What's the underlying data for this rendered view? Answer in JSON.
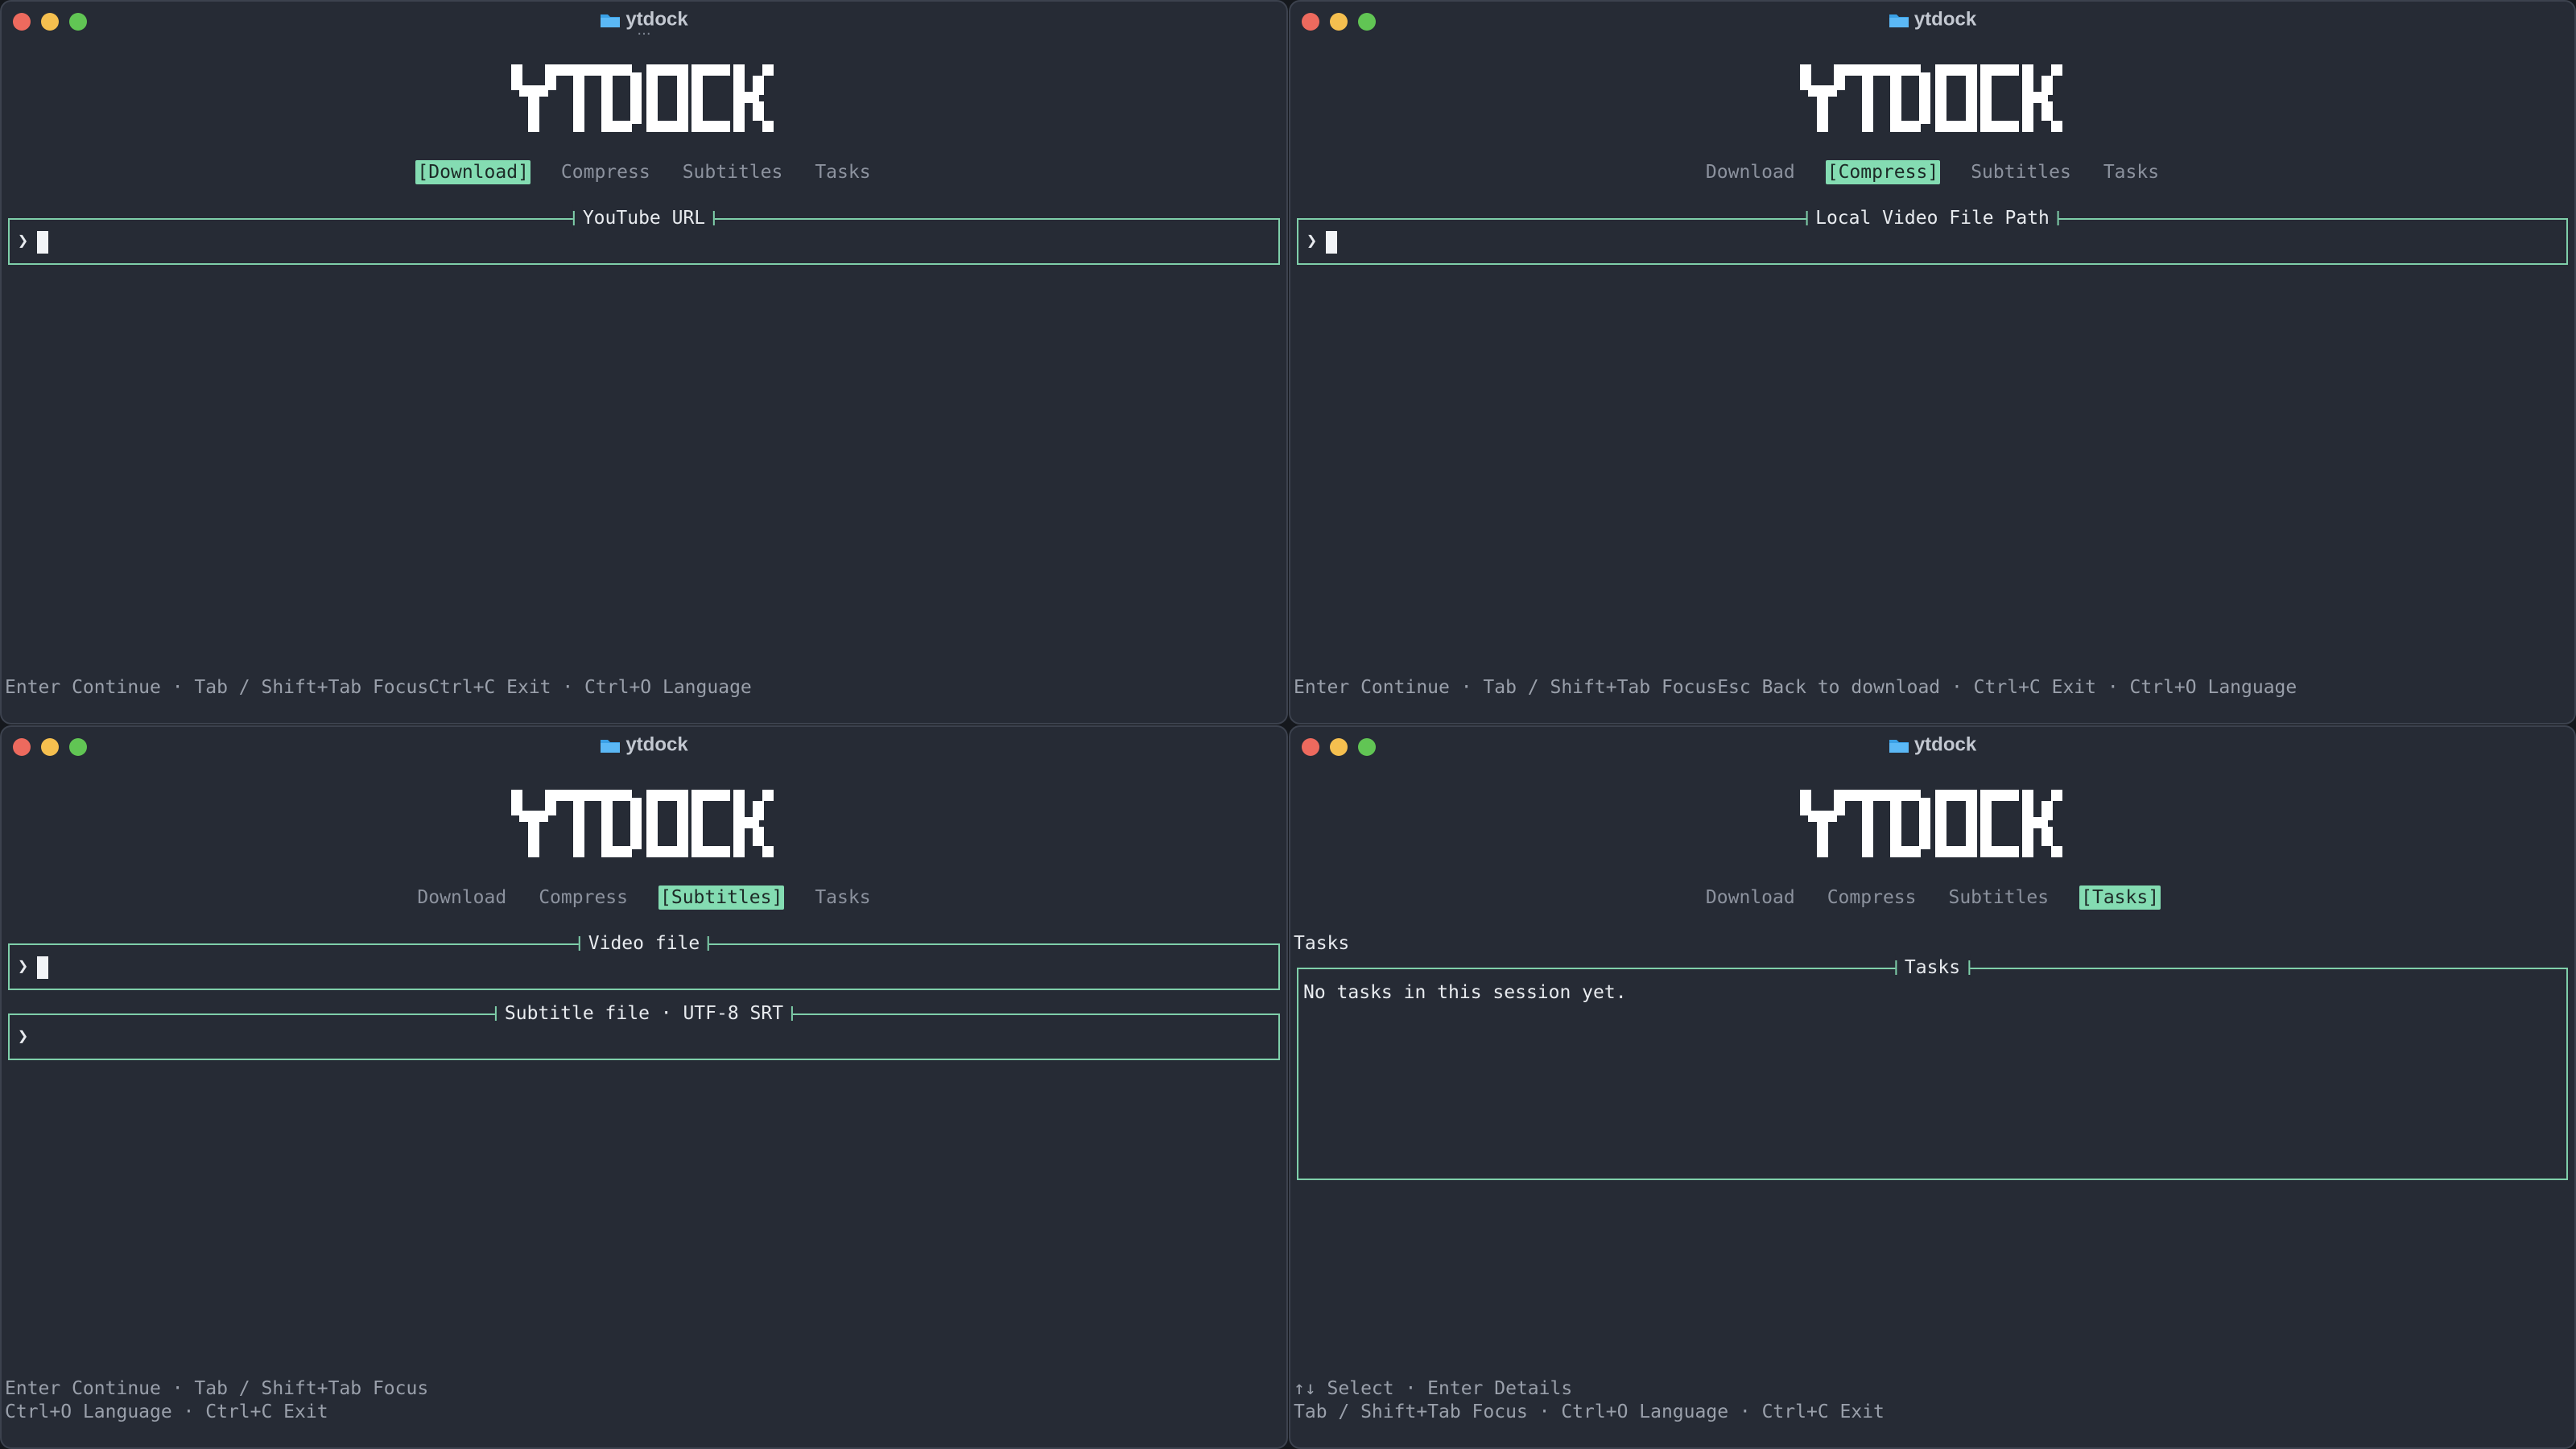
{
  "app": {
    "window_title": "ytdock",
    "logo_text": "YTDOCK",
    "prompt_symbol": "❯",
    "drag_handle": "···"
  },
  "tabs": [
    "Download",
    "Compress",
    "Subtitles",
    "Tasks"
  ],
  "panes": {
    "download": {
      "active_tab": "Download",
      "url_field": {
        "label": "YouTube URL",
        "value": ""
      },
      "hint_line": "Enter Continue · Tab / Shift+Tab FocusCtrl+C Exit · Ctrl+O Language"
    },
    "compress": {
      "active_tab": "Compress",
      "path_field": {
        "label": "Local Video File Path",
        "value": ""
      },
      "hint_line": "Enter Continue · Tab / Shift+Tab FocusEsc Back to download · Ctrl+C Exit · Ctrl+O Language"
    },
    "subtitles": {
      "active_tab": "Subtitles",
      "video_field": {
        "label": "Video file",
        "value": ""
      },
      "subtitle_field": {
        "label": "Subtitle file · UTF-8 SRT",
        "value": ""
      },
      "hint_line_1": "Enter Continue · Tab / Shift+Tab Focus",
      "hint_line_2": "Ctrl+O Language · Ctrl+C Exit"
    },
    "tasks": {
      "active_tab": "Tasks",
      "heading": "Tasks",
      "box_label": "Tasks",
      "empty_message": "No tasks in this session yet.",
      "hint_line_1": "↑↓ Select · Enter Details",
      "hint_line_2": "Tab / Shift+Tab Focus · Ctrl+O Language · Ctrl+C Exit"
    }
  },
  "colors": {
    "background": "#262b35",
    "accent": "#84dcb2",
    "border": "#7fcfaa",
    "hint_text": "#9aa0ab",
    "folder_icon": "#3aa0e6"
  },
  "icons": [
    "folder-icon",
    "close-light-icon",
    "minimize-light-icon",
    "zoom-light-icon"
  ]
}
